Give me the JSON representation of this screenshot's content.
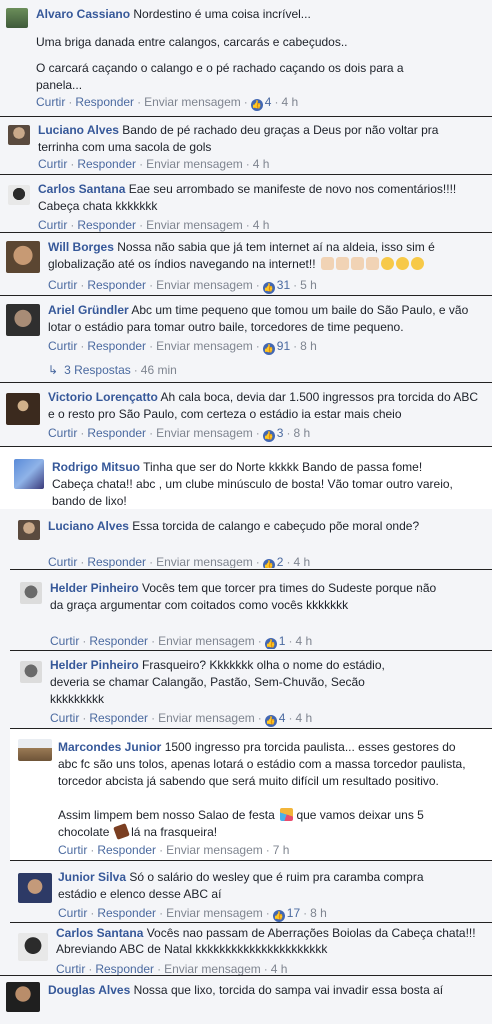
{
  "actions": {
    "like": "Curtir",
    "reply": "Responder",
    "message": "Enviar mensagem",
    "dot": "·"
  },
  "colors": {
    "link": "#365899",
    "like_badge": "#4267b2",
    "meta": "#7f8590"
  },
  "comments": [
    {
      "author": "Alvaro Cassiano",
      "p1": "Nordestino é uma coisa incrível...",
      "p2": "Uma briga danada entre calangos, carcarás e cabeçudos..",
      "p3": "O carcará caçando o calango e o pé rachado caçando os dois para a panela...",
      "likes": "4",
      "time": "4 h"
    },
    {
      "author": "Luciano Alves",
      "text": "Bando de pé rachado deu graças a Deus por não voltar pra terrinha com uma sacola de gols",
      "time": "4 h"
    },
    {
      "author": "Carlos Santana",
      "text": "Eae seu arrombado se manifeste de novo nos comentários!!!! Cabeça chata kkkkkkk",
      "time": "4 h"
    },
    {
      "author": "Will Borges",
      "text": "Nossa não sabia que já tem internet aí na aldeia, isso sim é globalização até os índios navegando na internet!!",
      "likes": "31",
      "time": "5 h"
    },
    {
      "author": "Ariel Gründler",
      "text": "Abc um time pequeno que tomou um baile do São Paulo, e vão lotar o estádio para tomar outro baile, torcedores de time pequeno.",
      "likes": "91",
      "time": "8 h",
      "replies": "3 Respostas",
      "replies_time": "46 min"
    },
    {
      "author": "Victorio Lorençatto",
      "text": "Ah cala boca, devia dar 1.500 ingressos pra torcida do ABC e o resto pro São Paulo, com certeza o estádio ia estar mais cheio",
      "likes": "3",
      "time": "8 h"
    },
    {
      "author": "Rodrigo Mitsuo",
      "text": "Tinha que ser do Norte kkkkk Bando de passa fome! Cabeça chata!! abc , um clube minúsculo de bosta! Vão tomar outro vareio, bando de lixo!"
    },
    {
      "author": "Luciano Alves",
      "text": "Essa torcida de calango e cabeçudo põe moral onde?",
      "likes": "2",
      "time": "4 h"
    },
    {
      "author": "Helder Pinheiro",
      "text": "Vocês tem que torcer pra times do Sudeste porque não da graça argumentar com coitados como vocês kkkkkkk",
      "likes": "1",
      "time": "4 h"
    },
    {
      "author": "Helder Pinheiro",
      "text": "Frasqueiro? Kkkkkkk olha o nome do estádio, deveria se chamar Calangão, Pastão, Sem-Chuvão, Secão kkkkkkkkk",
      "likes": "4",
      "time": "4 h"
    },
    {
      "author": "Marcondes Junior",
      "text": "1500 ingresso pra torcida paulista... esses gestores do abc fc são uns tolos, apenas lotará o estádio com a massa torcedor paulista, torcedor abcista já sabendo que será muito difícil um resultado positivo.",
      "text2a": "Assim limpem bem nosso Salao de festa",
      "text2b": "que vamos deixar uns 5",
      "text2c": "chocolate",
      "text2d": "lá na frasqueira!",
      "time": "7 h"
    },
    {
      "author": "Junior Silva",
      "text": "Só o salário do wesley que é ruim pra caramba compra estádio e elenco desse ABC aí",
      "likes": "17",
      "time": "8 h"
    },
    {
      "author": "Carlos Santana",
      "text": "Vocês nao passam de Aberrações Boiolas da Cabeça chata!!! Abreviando ABC de Natal kkkkkkkkkkkkkkkkkkkkkk",
      "time": "4 h"
    },
    {
      "author": "Douglas Alves",
      "text": "Nossa que lixo, torcida do sampa vai invadir essa bosta aí"
    }
  ]
}
